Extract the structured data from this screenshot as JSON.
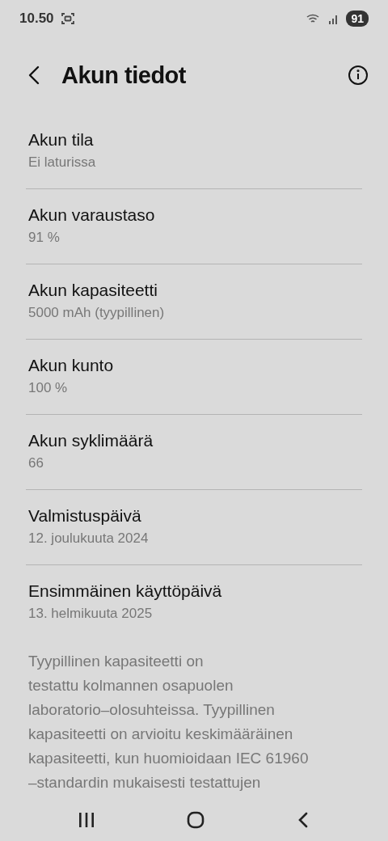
{
  "status_bar": {
    "time": "10.50",
    "battery": "91"
  },
  "header": {
    "title": "Akun tiedot"
  },
  "items": [
    {
      "title": "Akun tila",
      "value": "Ei laturissa"
    },
    {
      "title": "Akun varaustaso",
      "value": "91 %"
    },
    {
      "title": "Akun kapasiteetti",
      "value": "5000 mAh (tyypillinen)"
    },
    {
      "title": "Akun kunto",
      "value": "100 %"
    },
    {
      "title": "Akun syklimäärä",
      "value": "66"
    },
    {
      "title": "Valmistuspäivä",
      "value": "12. joulukuuta 2024"
    },
    {
      "title": "Ensimmäinen käyttöpäivä",
      "value": "13. helmikuuta 2025"
    }
  ],
  "note": "Tyypillinen kapasiteetti on\ntestattu kolmannen osapuolen\nlaboratorio–olosuhteissa. Tyypillinen\nkapasiteetti on arvioitu keskimääräinen\nkapasiteetti, kun huomioidaan IEC 61960\n–standardin mukaisesti testattujen"
}
